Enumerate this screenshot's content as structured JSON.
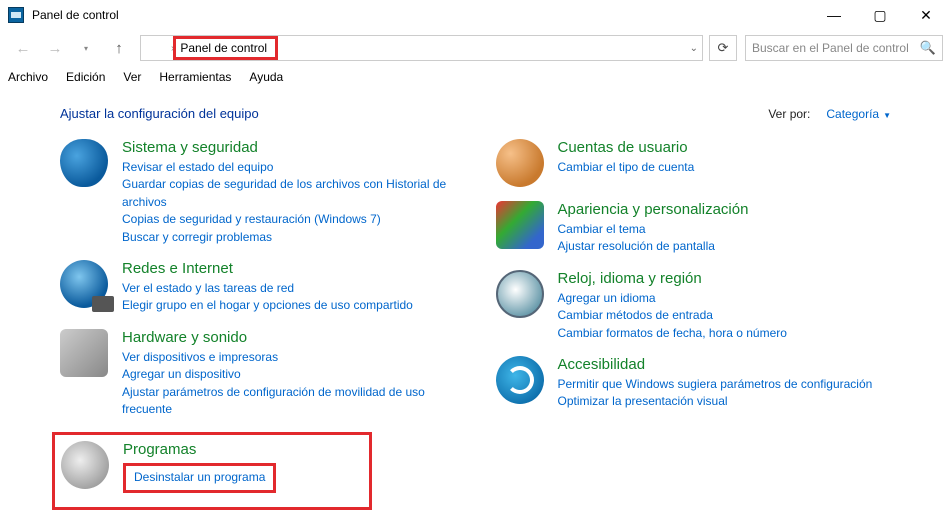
{
  "window": {
    "title": "Panel de control"
  },
  "address": {
    "crumb": "Panel de control"
  },
  "search": {
    "placeholder": "Buscar en el Panel de control"
  },
  "menu": {
    "file": "Archivo",
    "edit": "Edición",
    "view": "Ver",
    "tools": "Herramientas",
    "help": "Ayuda"
  },
  "header": {
    "title": "Ajustar la configuración del equipo",
    "viewby_label": "Ver por:",
    "viewby_value": "Categoría"
  },
  "cats": {
    "system": {
      "title": "Sistema y seguridad",
      "l1": "Revisar el estado del equipo",
      "l2": "Guardar copias de seguridad de los archivos con Historial de archivos",
      "l3": "Copias de seguridad y restauración (Windows 7)",
      "l4": "Buscar y corregir problemas"
    },
    "net": {
      "title": "Redes e Internet",
      "l1": "Ver el estado y las tareas de red",
      "l2": "Elegir grupo en el hogar y opciones de uso compartido"
    },
    "hw": {
      "title": "Hardware y sonido",
      "l1": "Ver dispositivos e impresoras",
      "l2": "Agregar un dispositivo",
      "l3": "Ajustar parámetros de configuración de movilidad de uso frecuente"
    },
    "prog": {
      "title": "Programas",
      "l1": "Desinstalar un programa"
    },
    "users": {
      "title": "Cuentas de usuario",
      "l1": "Cambiar el tipo de cuenta"
    },
    "appear": {
      "title": "Apariencia y personalización",
      "l1": "Cambiar el tema",
      "l2": "Ajustar resolución de pantalla"
    },
    "clock": {
      "title": "Reloj, idioma y región",
      "l1": "Agregar un idioma",
      "l2": "Cambiar métodos de entrada",
      "l3": "Cambiar formatos de fecha, hora o número"
    },
    "access": {
      "title": "Accesibilidad",
      "l1": "Permitir que Windows sugiera parámetros de configuración",
      "l2": "Optimizar la presentación visual"
    }
  }
}
